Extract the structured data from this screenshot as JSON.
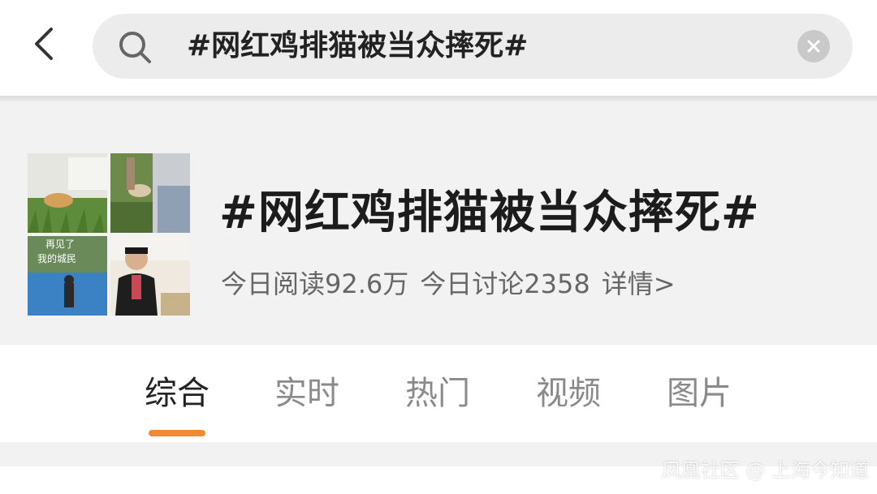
{
  "search": {
    "query": "#网红鸡排猫被当众摔死#"
  },
  "topic": {
    "title": "#网红鸡排猫被当众摔死#",
    "reads_today": "今日阅读92.6万",
    "discussions_today": "今日讨论2358",
    "details_link": "详情>",
    "cover_caption": "再见了 我的城民"
  },
  "tabs": [
    {
      "label": "综合",
      "active": true
    },
    {
      "label": "实时",
      "active": false
    },
    {
      "label": "热门",
      "active": false
    },
    {
      "label": "视频",
      "active": false
    },
    {
      "label": "图片",
      "active": false
    }
  ],
  "watermark": "凤凰社区 @ 上海今知道",
  "icons": {
    "back": "chevron-left-icon",
    "search": "search-icon",
    "clear": "clear-icon"
  },
  "colors": {
    "accent": "#f28a32",
    "search_bg": "#ececec",
    "card_bg": "#f2f2f2"
  }
}
